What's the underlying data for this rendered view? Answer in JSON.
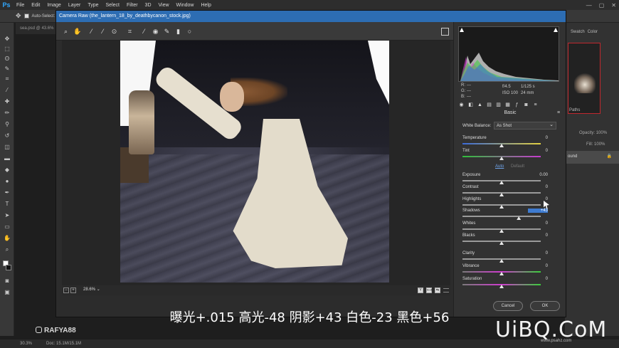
{
  "ps": {
    "logo": "Ps",
    "menu": [
      "File",
      "Edit",
      "Image",
      "Layer",
      "Type",
      "Select",
      "Filter",
      "3D",
      "View",
      "Window",
      "Help"
    ],
    "window_buttons": [
      "—",
      "▢",
      "✕"
    ],
    "options_bar": {
      "auto_select_label": "Auto-Select:"
    },
    "doc_tab": "sea.psd @ 43.6%",
    "right_panel": {
      "tabs": [
        "Swatch",
        "Color"
      ],
      "paths_label": "Paths",
      "opacity_label": "Opacity:",
      "opacity_value": "100%",
      "fill_label": "Fill:",
      "fill_value": "100%",
      "layer_name": "ound"
    },
    "status": {
      "zoom": "30.3%",
      "doc": "Doc: 15.1M/15.1M"
    }
  },
  "camera_raw": {
    "title": "Camera Raw (the_lantern_18_by_deathbycanon_stock.jpg)",
    "tools": [
      "zoom-icon",
      "hand-icon",
      "white-balance-icon",
      "color-sampler-icon",
      "targeted-adjust-icon",
      "crop-icon",
      "straighten-icon",
      "red-eye-icon",
      "adjustment-brush-icon",
      "graduated-filter-icon",
      "radial-filter-icon"
    ],
    "zoom_value": "28.6%",
    "view_buttons": [
      "Y",
      "⟷",
      "⇆"
    ],
    "camera": {
      "r_label": "R:",
      "g_label": "G:",
      "b_label": "B:",
      "r_value": "---",
      "g_value": "---",
      "b_value": "---",
      "aperture": "f/4.5",
      "shutter": "1/125 s",
      "iso": "ISO 100",
      "focal": "24 mm"
    },
    "panel_title": "Basic",
    "white_balance": {
      "label": "White Balance:",
      "value": "As Shot"
    },
    "auto_label": "Auto",
    "default_label": "Default",
    "sliders": [
      {
        "label": "Temperature",
        "value": "0",
        "pos": 0.5,
        "track": "temp"
      },
      {
        "label": "Tint",
        "value": "0",
        "pos": 0.5,
        "track": "tint"
      },
      {
        "label": "Exposure",
        "value": "0.00",
        "pos": 0.5,
        "track": "plain"
      },
      {
        "label": "Contrast",
        "value": "0",
        "pos": 0.5,
        "track": "plain"
      },
      {
        "label": "Highlights",
        "value": "0",
        "pos": 0.5,
        "track": "plain"
      },
      {
        "label": "Shadows",
        "value": "+43",
        "pos": 0.72,
        "track": "plain",
        "selected": true
      },
      {
        "label": "Whites",
        "value": "0",
        "pos": 0.5,
        "track": "plain"
      },
      {
        "label": "Blacks",
        "value": "0",
        "pos": 0.5,
        "track": "plain"
      },
      {
        "label": "Clarity",
        "value": "0",
        "pos": 0.5,
        "track": "plain"
      },
      {
        "label": "Vibrance",
        "value": "0",
        "pos": 0.5,
        "track": "vib"
      },
      {
        "label": "Saturation",
        "value": "0",
        "pos": 0.5,
        "track": "vib"
      }
    ],
    "cancel_label": "Cancel",
    "ok_label": "OK"
  },
  "overlay": {
    "subtitle": "曝光+.015  高光-48  阴影+43  白色-23  黑色+56",
    "watermark_left": "RAFYA88",
    "watermark_right": "UiBQ.CoM",
    "watermark_right_sub": "www.psahz.com"
  }
}
